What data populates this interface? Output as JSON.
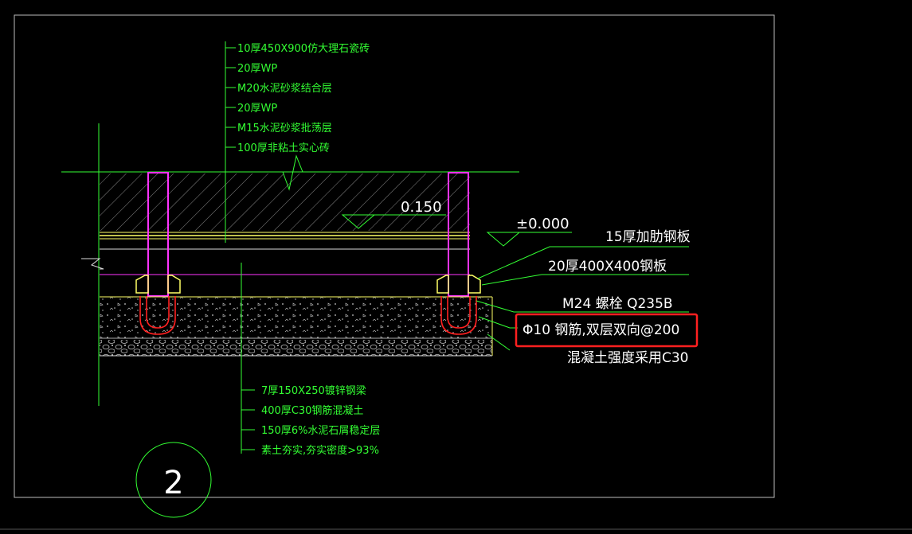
{
  "top_layers": [
    "10厚450X900仿大理石瓷砖",
    "20厚WP",
    "M20水泥砂浆结合层",
    "20厚WP",
    "M15水泥砂浆批荡层",
    "100厚非粘土实心砖"
  ],
  "bottom_layers": [
    "7厚150X250镀锌钢梁",
    "400厚C30钢筋混凝土",
    "150厚6%水泥石屑稳定层",
    "素土夯实,夯实密度>93%"
  ],
  "level_a": "0.150",
  "level_b": "±0.000",
  "right_labels": [
    "15厚加肋钢板",
    "20厚400X400钢板",
    "M24 螺栓 Q235B",
    "Φ10 钢筋,双层双向@200",
    "混凝土强度采用C30"
  ],
  "highlighted_index": 3,
  "highlight_color": "#ff2020",
  "detail_number": "2",
  "colors": {
    "background": "#000000",
    "green": "#33ff33",
    "white": "#ffffff",
    "magenta": "#ff33ff",
    "yellow": "#ffff66",
    "red": "#ff2020"
  }
}
